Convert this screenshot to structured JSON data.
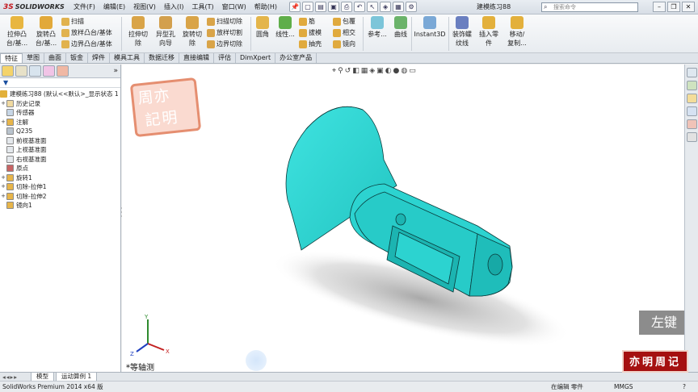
{
  "app": {
    "logo_ds": "3S",
    "logo_text": "SOLIDWORKS"
  },
  "menu": [
    "文件(F)",
    "编辑(E)",
    "视图(V)",
    "插入(I)",
    "工具(T)",
    "窗口(W)",
    "帮助(H)"
  ],
  "document_title": "建模练习88",
  "search": {
    "placeholder": "搜索命令"
  },
  "commands": {
    "extrude_boss": "拉伸凸\n台/基...",
    "revolve_boss": "旋转凸\n台/基...",
    "sweep": "扫描",
    "loft_boss": "放样凸台/基体",
    "boundary_boss": "边界凸台/基体",
    "extrude_cut": "拉伸切\n除",
    "hole_wizard": "异型孔\n向导",
    "revolve_cut": "旋转切\n除",
    "swept_cut": "扫描切除",
    "lofted_cut": "放样切割",
    "boundary_cut": "边界切除",
    "fillet": "圆角",
    "linear_pattern": "线性...",
    "rib": "筋",
    "draft": "拔模",
    "shell": "抽壳",
    "wrap": "包覆",
    "intersect": "相交",
    "mirror": "镜向",
    "reference": "参考...",
    "curves": "曲线",
    "instant3d": "Instant3D",
    "thread": "装饰螺\n纹线",
    "insert_part": "插入零\n件",
    "move_copy": "移动/\n复制..."
  },
  "tabs": [
    "特征",
    "草图",
    "曲面",
    "钣金",
    "焊件",
    "模具工具",
    "数据迁移",
    "直接编辑",
    "评估",
    "DimXpert",
    "办公室产品"
  ],
  "tree": {
    "root": "建模练习88  (默认<<默认>_显示状态 1",
    "items": [
      {
        "label": "历史记录",
        "exp": "+"
      },
      {
        "label": "传感器",
        "exp": ""
      },
      {
        "label": "注解",
        "exp": "+"
      },
      {
        "label": "Q235",
        "exp": ""
      },
      {
        "label": "前视基准面",
        "exp": ""
      },
      {
        "label": "上视基准面",
        "exp": ""
      },
      {
        "label": "右视基准面",
        "exp": ""
      },
      {
        "label": "原点",
        "exp": ""
      },
      {
        "label": "旋转1",
        "exp": "+"
      },
      {
        "label": "切除-拉伸1",
        "exp": "+"
      },
      {
        "label": "切除-拉伸2",
        "exp": "+"
      },
      {
        "label": "镜向1",
        "exp": ""
      }
    ]
  },
  "viewport": {
    "view_name": "*等轴测",
    "watermark_top": "周亦",
    "watermark_bottom": "記明",
    "key_overlay": "左键",
    "model_color": "#2cd3d0",
    "axes": {
      "x": "X",
      "y": "Y",
      "z": "Z"
    }
  },
  "bottom_tabs": [
    "模型",
    "运动算例 1"
  ],
  "status": {
    "version": "SolidWorks Premium 2014 x64 版",
    "mode": "在编辑 零件",
    "units": "MMGS",
    "help": "?"
  },
  "red_stamp": "亦明周记",
  "colors": {
    "accent": "#c3161c",
    "model": "#2cd3d0",
    "model_dark": "#1aa6a3"
  }
}
